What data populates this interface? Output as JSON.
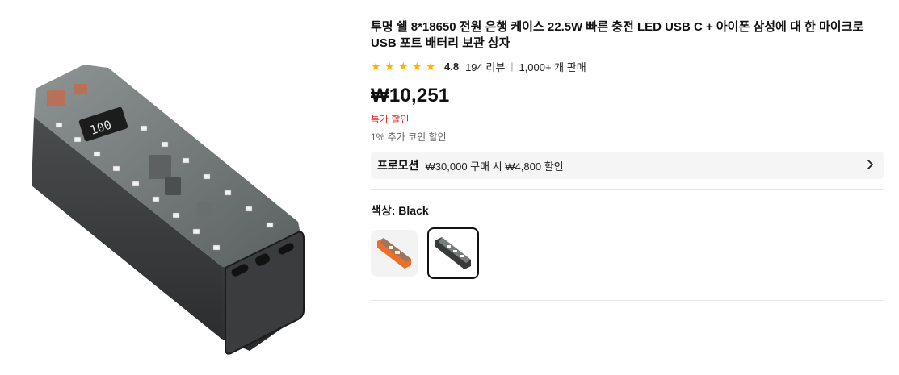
{
  "product": {
    "title": "투명 쉘 8*18650 전원 은행 케이스 22.5W 빠른 충전 LED USB C + 아이폰 삼성에 대 한 마이크로 USB 포트 배터리 보관 상자",
    "rating": "4.8",
    "reviews": "194 리뷰",
    "sold": "1,000+ 개 판매",
    "price": "₩10,251",
    "sale_label": "특가 할인",
    "coin_discount": "1% 추가 코인 할인"
  },
  "promotion": {
    "title": "프로모션",
    "text": "₩30,000 구매 시 ₩4,800 할인"
  },
  "color": {
    "label": "색상: Black",
    "options": [
      {
        "accent": "#e8702a",
        "selected": false
      },
      {
        "accent": "#3a3a3a",
        "selected": true
      }
    ]
  },
  "colors": {
    "star": "#ffb400",
    "sale": "#e0292b",
    "promo_bg": "#f5f5f5"
  }
}
